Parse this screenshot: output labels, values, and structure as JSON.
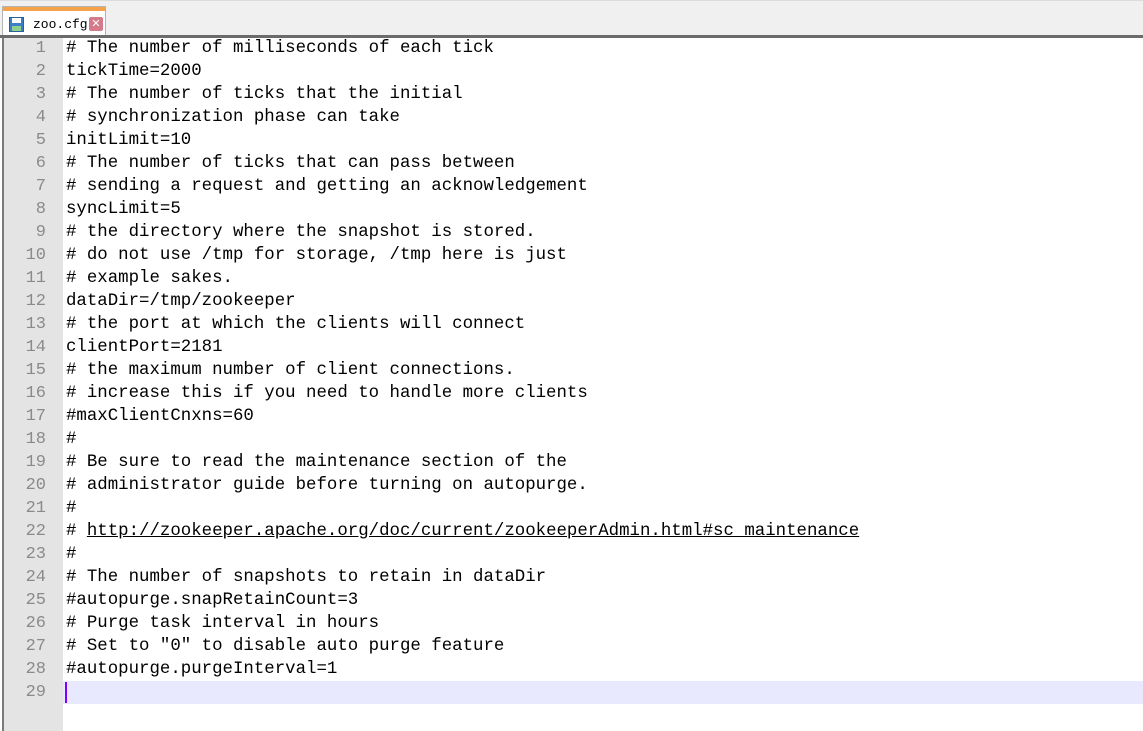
{
  "tab": {
    "icon": "save-disk-icon",
    "filename": "zoo.cfg",
    "close_icon": "close-icon",
    "accent_color": "#f6a24a"
  },
  "editor": {
    "current_line": 29,
    "lines": [
      {
        "n": "1",
        "text": "# The number of milliseconds of each tick"
      },
      {
        "n": "2",
        "text": "tickTime=2000"
      },
      {
        "n": "3",
        "text": "# The number of ticks that the initial"
      },
      {
        "n": "4",
        "text": "# synchronization phase can take"
      },
      {
        "n": "5",
        "text": "initLimit=10"
      },
      {
        "n": "6",
        "text": "# The number of ticks that can pass between"
      },
      {
        "n": "7",
        "text": "# sending a request and getting an acknowledgement"
      },
      {
        "n": "8",
        "text": "syncLimit=5"
      },
      {
        "n": "9",
        "text": "# the directory where the snapshot is stored."
      },
      {
        "n": "10",
        "text": "# do not use /tmp for storage, /tmp here is just"
      },
      {
        "n": "11",
        "text": "# example sakes."
      },
      {
        "n": "12",
        "text": "dataDir=/tmp/zookeeper"
      },
      {
        "n": "13",
        "text": "# the port at which the clients will connect"
      },
      {
        "n": "14",
        "text": "clientPort=2181"
      },
      {
        "n": "15",
        "text": "# the maximum number of client connections."
      },
      {
        "n": "16",
        "text": "# increase this if you need to handle more clients"
      },
      {
        "n": "17",
        "text": "#maxClientCnxns=60"
      },
      {
        "n": "18",
        "text": "#"
      },
      {
        "n": "19",
        "text": "# Be sure to read the maintenance section of the"
      },
      {
        "n": "20",
        "text": "# administrator guide before turning on autopurge."
      },
      {
        "n": "21",
        "text": "#"
      },
      {
        "n": "22",
        "text": "# ",
        "link": "http://zookeeper.apache.org/doc/current/zookeeperAdmin.html#sc_maintenance"
      },
      {
        "n": "23",
        "text": "#"
      },
      {
        "n": "24",
        "text": "# The number of snapshots to retain in dataDir"
      },
      {
        "n": "25",
        "text": "#autopurge.snapRetainCount=3"
      },
      {
        "n": "26",
        "text": "# Purge task interval in hours"
      },
      {
        "n": "27",
        "text": "# Set to \"0\" to disable auto purge feature"
      },
      {
        "n": "28",
        "text": "#autopurge.purgeInterval=1"
      },
      {
        "n": "29",
        "text": ""
      }
    ]
  }
}
